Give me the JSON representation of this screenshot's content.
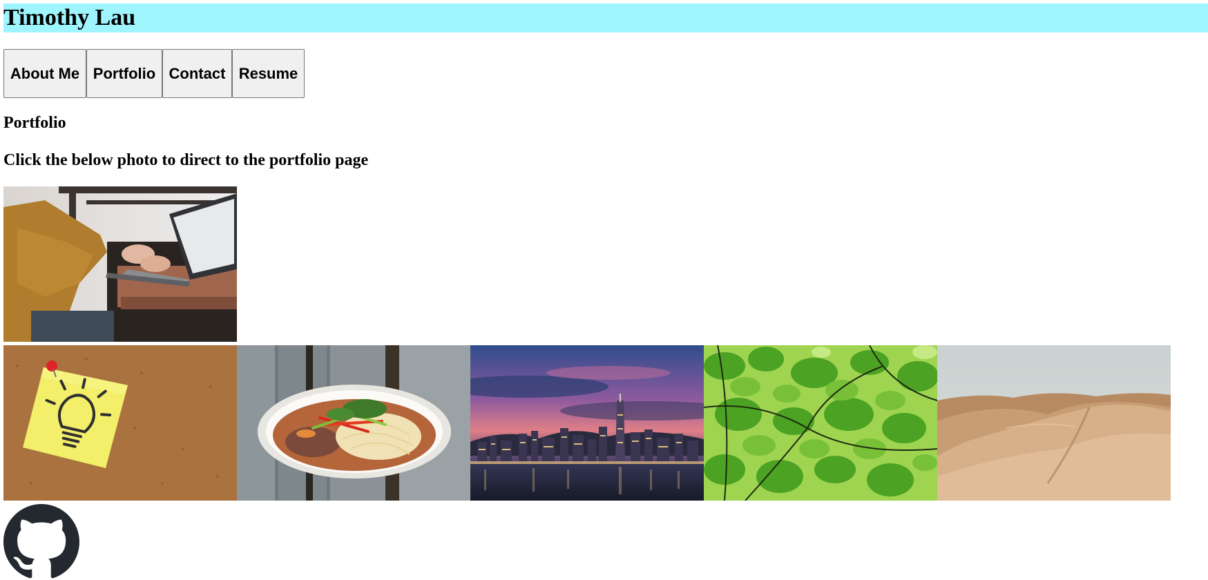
{
  "header": {
    "title": "Timothy Lau",
    "background": "#9ff5fd"
  },
  "nav": {
    "items": [
      {
        "label": "About Me"
      },
      {
        "label": "Portfolio"
      },
      {
        "label": "Contact"
      },
      {
        "label": "Resume"
      }
    ]
  },
  "main": {
    "section_title": "Portfolio",
    "instruction": "Click the below photo to direct to the portfolio page"
  },
  "photos": [
    {
      "subject": "person typing on laptop"
    },
    {
      "subject": "lightbulb sticky note on corkboard"
    },
    {
      "subject": "noodle bowl on wooden table"
    },
    {
      "subject": "city skyline at dusk"
    },
    {
      "subject": "green leaves"
    },
    {
      "subject": "desert sand dunes"
    }
  ],
  "footer": {
    "icon": "github-icon"
  }
}
